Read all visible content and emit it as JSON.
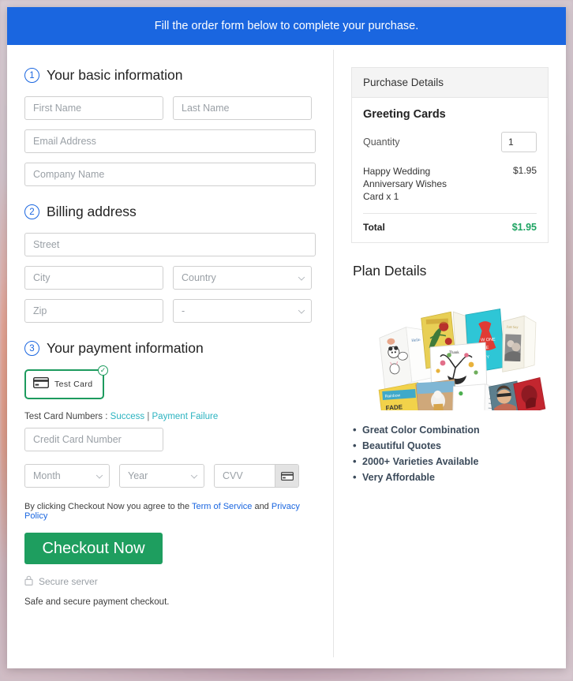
{
  "banner": {
    "text": "Fill the order form below to complete your purchase."
  },
  "form": {
    "step1": {
      "number": "1",
      "title": "Your basic information",
      "fields": [
        {
          "name": "first-name",
          "placeholder": "First Name"
        },
        {
          "name": "last-name",
          "placeholder": "Last Name"
        },
        {
          "name": "email",
          "placeholder": "Email Address"
        },
        {
          "name": "company",
          "placeholder": "Company Name"
        }
      ]
    },
    "step2": {
      "number": "2",
      "title": "Billing address",
      "fields": [
        {
          "name": "street",
          "placeholder": "Street"
        },
        {
          "name": "city",
          "placeholder": "City"
        },
        {
          "name": "country",
          "placeholder": "Country"
        },
        {
          "name": "zip",
          "placeholder": "Zip"
        },
        {
          "name": "state",
          "placeholder": "-"
        }
      ]
    },
    "step3": {
      "number": "3",
      "title": "Your payment information",
      "test_card_label": "Test  Card",
      "check_glyph": "✓",
      "test_numbers_prefix": "Test Card Numbers : ",
      "test_numbers_success": "Success",
      "test_numbers_separator": " | ",
      "test_numbers_failure": "Payment Failure",
      "card_number_placeholder": "Credit Card Number",
      "month_placeholder": "Month",
      "year_placeholder": "Year",
      "cvv_placeholder": "CVV"
    },
    "terms": {
      "prefix": "By clicking Checkout Now you agree to the ",
      "link1": "Term of Service",
      "middle": " and ",
      "link2": "Privacy Policy"
    },
    "checkout_button": "Checkout Now",
    "secure_server": "Secure server",
    "safe_note": "Safe and secure payment checkout."
  },
  "purchase_details": {
    "header": "Purchase Details",
    "product": "Greeting Cards",
    "quantity_label": "Quantity",
    "quantity_value": "1",
    "item_name": "Happy Wedding Anniversary Wishes Card x 1",
    "item_price": "$1.95",
    "total_label": "Total",
    "total_value": "$1.95"
  },
  "plan_details": {
    "title": "Plan Details",
    "image_alt": "greeting-cards-collage",
    "bullets": [
      "Great Color Combination",
      "Beautiful Quotes",
      "2000+ Varieties Available",
      "Very Affordable"
    ]
  },
  "colors": {
    "banner_blue": "#1a66e0",
    "accent_green": "#1e9e5f",
    "total_green": "#1fa463",
    "link_blue": "#1a66e0",
    "link_teal": "#2bb3c0",
    "bullet_text": "#3b4a5a"
  }
}
